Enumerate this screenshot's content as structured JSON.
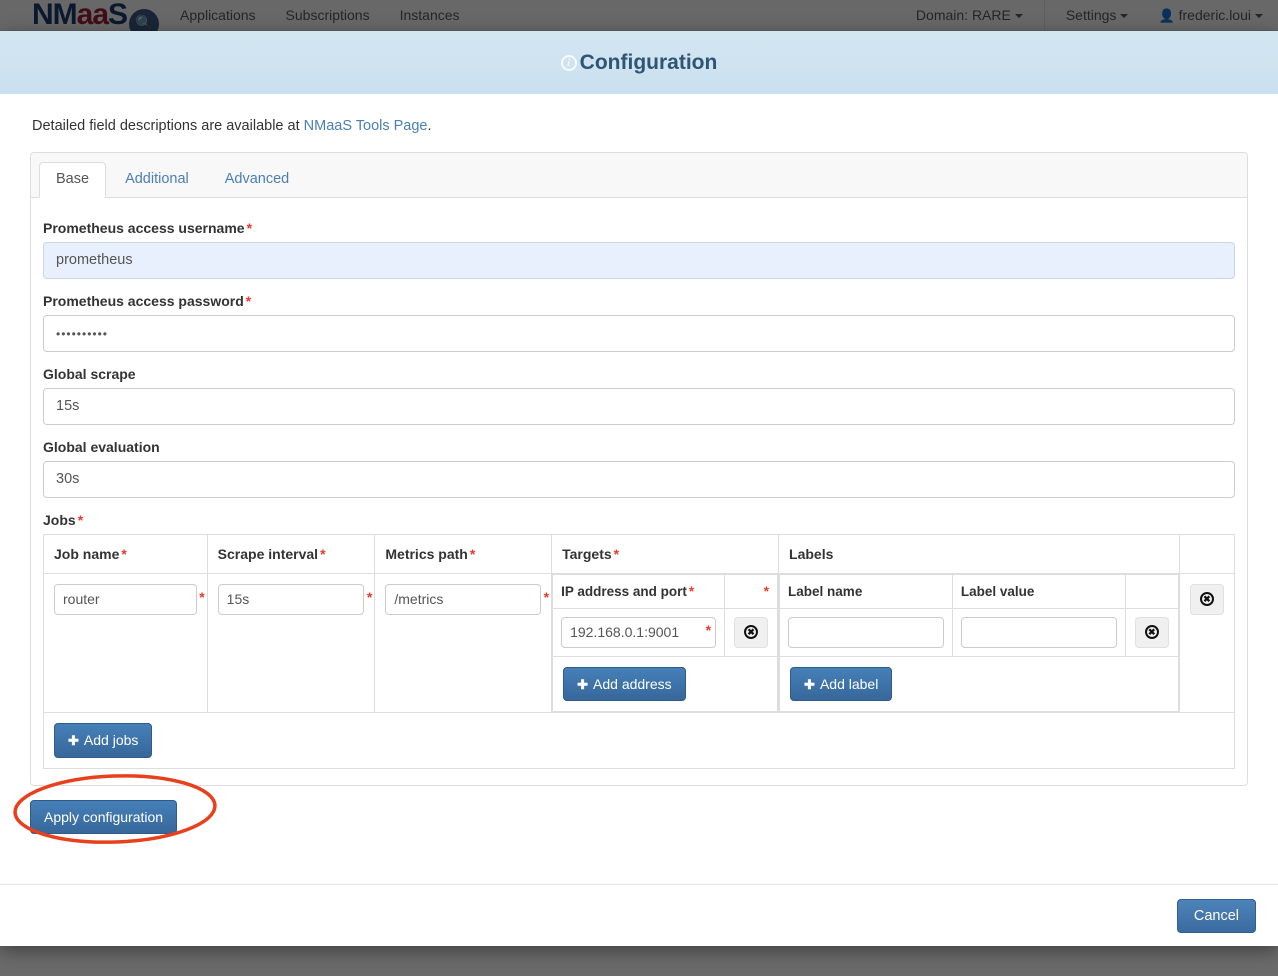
{
  "navbar": {
    "brand": {
      "part1": "NM",
      "part2": "aa",
      "part3": "S",
      "badge_icon": "wrench-magnifier-icon"
    },
    "links": [
      "Applications",
      "Subscriptions",
      "Instances"
    ],
    "domain_label": "Domain: RARE",
    "settings_label": "Settings",
    "user_label": "frederic.loui"
  },
  "modal": {
    "title": "Configuration",
    "title_icon": "info-circle-icon",
    "intro_prefix": "Detailed field descriptions are available at ",
    "intro_link": "NMaaS Tools Page",
    "intro_suffix": ".",
    "tabs": [
      {
        "label": "Base",
        "active": true
      },
      {
        "label": "Additional",
        "active": false
      },
      {
        "label": "Advanced",
        "active": false
      }
    ],
    "fields": [
      {
        "label": "Prometheus access username",
        "required": true,
        "value": "prometheus",
        "autofill": true
      },
      {
        "label": "Prometheus access password",
        "required": true,
        "value": "••••••••••",
        "autofill": false
      },
      {
        "label": "Global scrape",
        "required": false,
        "value": "15s",
        "autofill": false
      },
      {
        "label": "Global evaluation",
        "required": false,
        "value": "30s",
        "autofill": false
      }
    ],
    "jobs_section": {
      "label": "Jobs",
      "required": true,
      "headers": [
        {
          "text": "Job name",
          "required": true
        },
        {
          "text": "Scrape interval",
          "required": true
        },
        {
          "text": "Metrics path",
          "required": true
        },
        {
          "text": "Targets",
          "required": true
        },
        {
          "text": "Labels",
          "required": false
        },
        {
          "text": "",
          "required": false
        }
      ],
      "row": {
        "job_name": "router",
        "scrape_interval": "15s",
        "metrics_path": "/metrics",
        "targets": {
          "header": "IP address and port",
          "header_required": true,
          "addresses": [
            "192.168.0.1:9001"
          ],
          "add_button": "Add address",
          "delete_icon": "circle-x-icon"
        },
        "labels": {
          "header_name": "Label name",
          "header_value": "Label value",
          "rows": [
            {
              "name": "",
              "value": ""
            }
          ],
          "add_button": "Add label",
          "delete_icon": "circle-x-icon"
        },
        "delete_icon": "circle-x-icon"
      },
      "add_jobs_button": "Add jobs"
    },
    "apply_button": "Apply configuration",
    "cancel_button": "Cancel",
    "annotation": {
      "shape": "ellipse",
      "color": "#e8401c",
      "target": "apply-configuration-button"
    }
  }
}
